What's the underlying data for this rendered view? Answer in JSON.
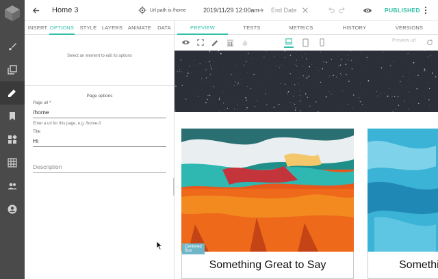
{
  "topbar": {
    "page_title": "Home 3",
    "url_path": "Url path is /home",
    "start_date": "2019/11/29 12:00am",
    "end_date": "End Date",
    "status": "PUBLISHED"
  },
  "left_panel": {
    "tabs": [
      "INSERT",
      "OPTIONS",
      "STYLE",
      "LAYERS",
      "ANIMATE",
      "DATA"
    ],
    "active_tab": "OPTIONS",
    "select_hint": "Select an element to edit its options",
    "section_title": "Page options",
    "page_url_label": "Page url *",
    "page_url_value": "/home",
    "page_url_help": "Enter a url for this page, e.g. /home-3",
    "title_label": "Title",
    "title_value": "Hi",
    "description_placeholder": "Description"
  },
  "preview": {
    "tabs": [
      "PREVIEW",
      "TESTS",
      "METRICS",
      "HISTORY",
      "VERSIONS"
    ],
    "active_tab": "PREVIEW",
    "preview_url": "Preview url",
    "cards": [
      {
        "badge": "Centered Box",
        "title": "Something Great to Say"
      },
      {
        "title": "Somethi"
      }
    ]
  },
  "colors": {
    "accent": "#2fbfa8",
    "rail": "#4a4a4a",
    "hero": "#2b2f37"
  },
  "icons": [
    "back-arrow-icon",
    "location-icon",
    "arrow-right-icon",
    "close-icon",
    "undo-icon",
    "redo-icon",
    "eye-icon",
    "more-vert-icon",
    "brush-icon",
    "layers-icon",
    "edit-icon",
    "bookmark-icon",
    "widgets-icon",
    "grid-icon",
    "people-icon",
    "account-icon",
    "fullscreen-icon",
    "pencil-icon",
    "table-icon",
    "fire-icon",
    "laptop-icon",
    "tablet-icon",
    "phone-icon",
    "refresh-icon"
  ]
}
